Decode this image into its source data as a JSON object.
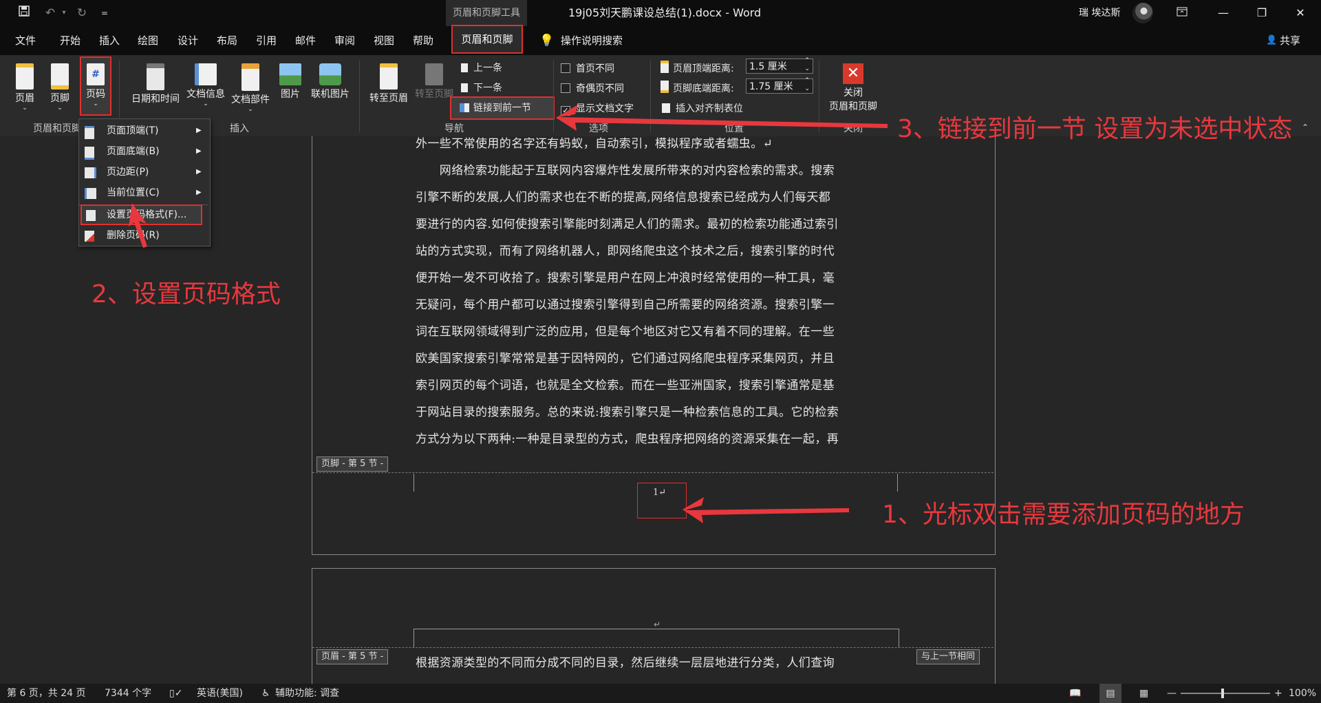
{
  "titlebar": {
    "context_tab": "页眉和页脚工具",
    "title": "19j05刘天鹏课设总结(1).docx  -  Word",
    "user": "瑞 埃达斯",
    "qat_more": "="
  },
  "menu": {
    "tabs": [
      "文件",
      "开始",
      "插入",
      "绘图",
      "设计",
      "布局",
      "引用",
      "邮件",
      "审阅",
      "视图",
      "帮助"
    ],
    "active_tab": "页眉和页脚",
    "search": "操作说明搜索",
    "share": "共享"
  },
  "ribbon": {
    "header": "页眉",
    "footer": "页脚",
    "page_number": "页码",
    "datetime": "日期和时间",
    "docinfo": "文档信息",
    "docparts": "文档部件",
    "picture": "图片",
    "online_picture": "联机图片",
    "goto_header": "转至页眉",
    "goto_footer": "转至页脚",
    "prev": "上一条",
    "next": "下一条",
    "link_prev": "链接到前一节",
    "first_page_diff": "首页不同",
    "odd_even_diff": "奇偶页不同",
    "show_doc_text": "显示文档文字",
    "header_top_label": "页眉顶端距离:",
    "header_top_value": "1.5 厘米",
    "footer_bottom_label": "页脚底端距离:",
    "footer_bottom_value": "1.75 厘米",
    "insert_tab": "插入对齐制表位",
    "close_line1": "关闭",
    "close_line2": "页眉和页脚",
    "groups": {
      "hf": "页眉和页脚",
      "insert": "插入",
      "nav": "导航",
      "options": "选项",
      "position": "位置",
      "close": "关闭"
    },
    "show_doc_text_checked": true
  },
  "dropdown": [
    {
      "label": "页面顶端(T)",
      "has_sub": true
    },
    {
      "label": "页面底端(B)",
      "has_sub": true
    },
    {
      "label": "页边距(P)",
      "has_sub": true
    },
    {
      "label": "当前位置(C)",
      "has_sub": true
    },
    {
      "label": "设置页码格式(F)...",
      "has_sub": false
    },
    {
      "label": "删除页码(R)",
      "has_sub": false
    }
  ],
  "document": {
    "lines": [
      "外一些不常使用的名字还有蚂蚁，自动索引，模拟程序或者蠕虫。↵",
      "　　网络检索功能起于互联网内容爆炸性发展所带来的对内容检索的需求。搜索",
      "引擎不断的发展,人们的需求也在不断的提高,网络信息搜索已经成为人们每天都",
      "要进行的内容.如何使搜索引擎能时刻满足人们的需求。最初的检索功能通过索引",
      "站的方式实现，而有了网络机器人，即网络爬虫这个技术之后，搜索引擎的时代",
      "便开始一发不可收拾了。搜索引擎是用户在网上冲浪时经常使用的一种工具，毫",
      "无疑问，每个用户都可以通过搜索引擎得到自己所需要的网络资源。搜索引擎一",
      "词在互联网领域得到广泛的应用，但是每个地区对它又有着不同的理解。在一些",
      "欧美国家搜索引擎常常是基于因特网的，它们通过网络爬虫程序采集网页，并且",
      "索引网页的每个词语，也就是全文检索。而在一些亚洲国家，搜索引擎通常是基",
      "于网站目录的搜索服务。总的来说:搜索引擎只是一种检索信息的工具。它的检索",
      "方式分为以下两种:一种是目录型的方式，爬虫程序把网络的资源采集在一起，再"
    ],
    "footer_tag": "页脚 - 第 5 节 -",
    "footer_content": "1↵",
    "header_tag": "页眉 - 第 5 节 -",
    "header_mark": "↵",
    "same_as_prev": "与上一节相同",
    "next_line": "根据资源类型的不同而分成不同的目录，然后继续一层层地进行分类，人们查询"
  },
  "annotations": {
    "step1": "1、光标双击需要添加页码的地方",
    "step2": "2、设置页码格式",
    "step3": "3、链接到前一节 设置为未选中状态"
  },
  "status": {
    "page": "第 6 页，共 24 页",
    "words": "7344 个字",
    "lang": "英语(美国)",
    "accessibility": "辅助功能: 调查",
    "zoom": "100%",
    "minus": "—",
    "plus": "+"
  },
  "colors": {
    "annotation_red": "#e8383d",
    "ribbon_bg": "#2b2b2b",
    "title_bg": "#0d0d0d"
  }
}
